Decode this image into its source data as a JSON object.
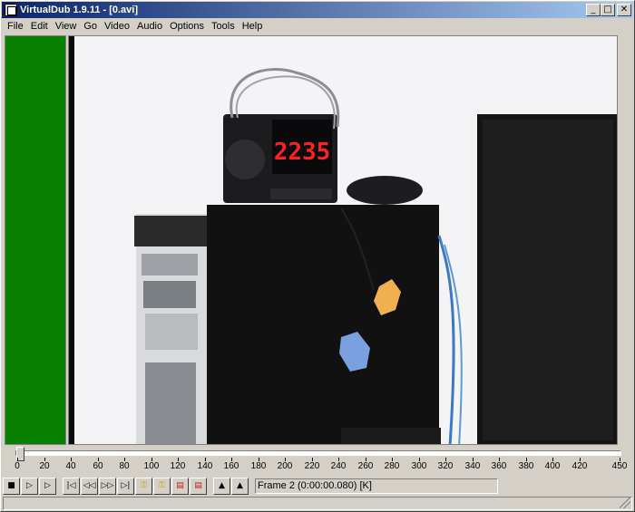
{
  "window": {
    "title": "VirtualDub 1.9.11 - [0.avi]",
    "buttons": {
      "minimize": "_",
      "maximize": "□",
      "close": "✕"
    }
  },
  "menu": [
    "File",
    "Edit",
    "View",
    "Go",
    "Video",
    "Audio",
    "Options",
    "Tools",
    "Help"
  ],
  "video": {
    "clock_display": "2235"
  },
  "timeline": {
    "ticks": [
      "0",
      "20",
      "40",
      "60",
      "80",
      "100",
      "120",
      "140",
      "160",
      "180",
      "200",
      "220",
      "240",
      "260",
      "280",
      "300",
      "320",
      "340",
      "360",
      "380",
      "400",
      "420",
      "450"
    ],
    "max_frame": 450,
    "current_frame": 2
  },
  "toolbar": {
    "buttons": [
      {
        "name": "stop-button",
        "icon": "stop-icon"
      },
      {
        "name": "play-input-button",
        "icon": "play-input-icon"
      },
      {
        "name": "play-output-button",
        "icon": "play-output-icon"
      },
      {
        "name": "go-start-button",
        "icon": "go-start-icon"
      },
      {
        "name": "prev-frame-button",
        "icon": "prev-frame-icon"
      },
      {
        "name": "next-frame-button",
        "icon": "next-frame-icon"
      },
      {
        "name": "go-end-button",
        "icon": "go-end-icon"
      },
      {
        "name": "prev-keyframe-button",
        "icon": "key-prev-icon"
      },
      {
        "name": "next-keyframe-button",
        "icon": "key-next-icon"
      },
      {
        "name": "prev-scene-button",
        "icon": "scene-prev-icon"
      },
      {
        "name": "next-scene-button",
        "icon": "scene-next-icon"
      },
      {
        "name": "mark-in-button",
        "icon": "mark-in-icon"
      },
      {
        "name": "mark-out-button",
        "icon": "mark-out-icon"
      }
    ],
    "frame_text": "Frame 2 (0:00:00.080) [K]"
  },
  "colors": {
    "title_start": "#0a246a",
    "title_end": "#a6caf0",
    "input_pane": "#0a8000",
    "clock_digits": "#ff2020"
  }
}
